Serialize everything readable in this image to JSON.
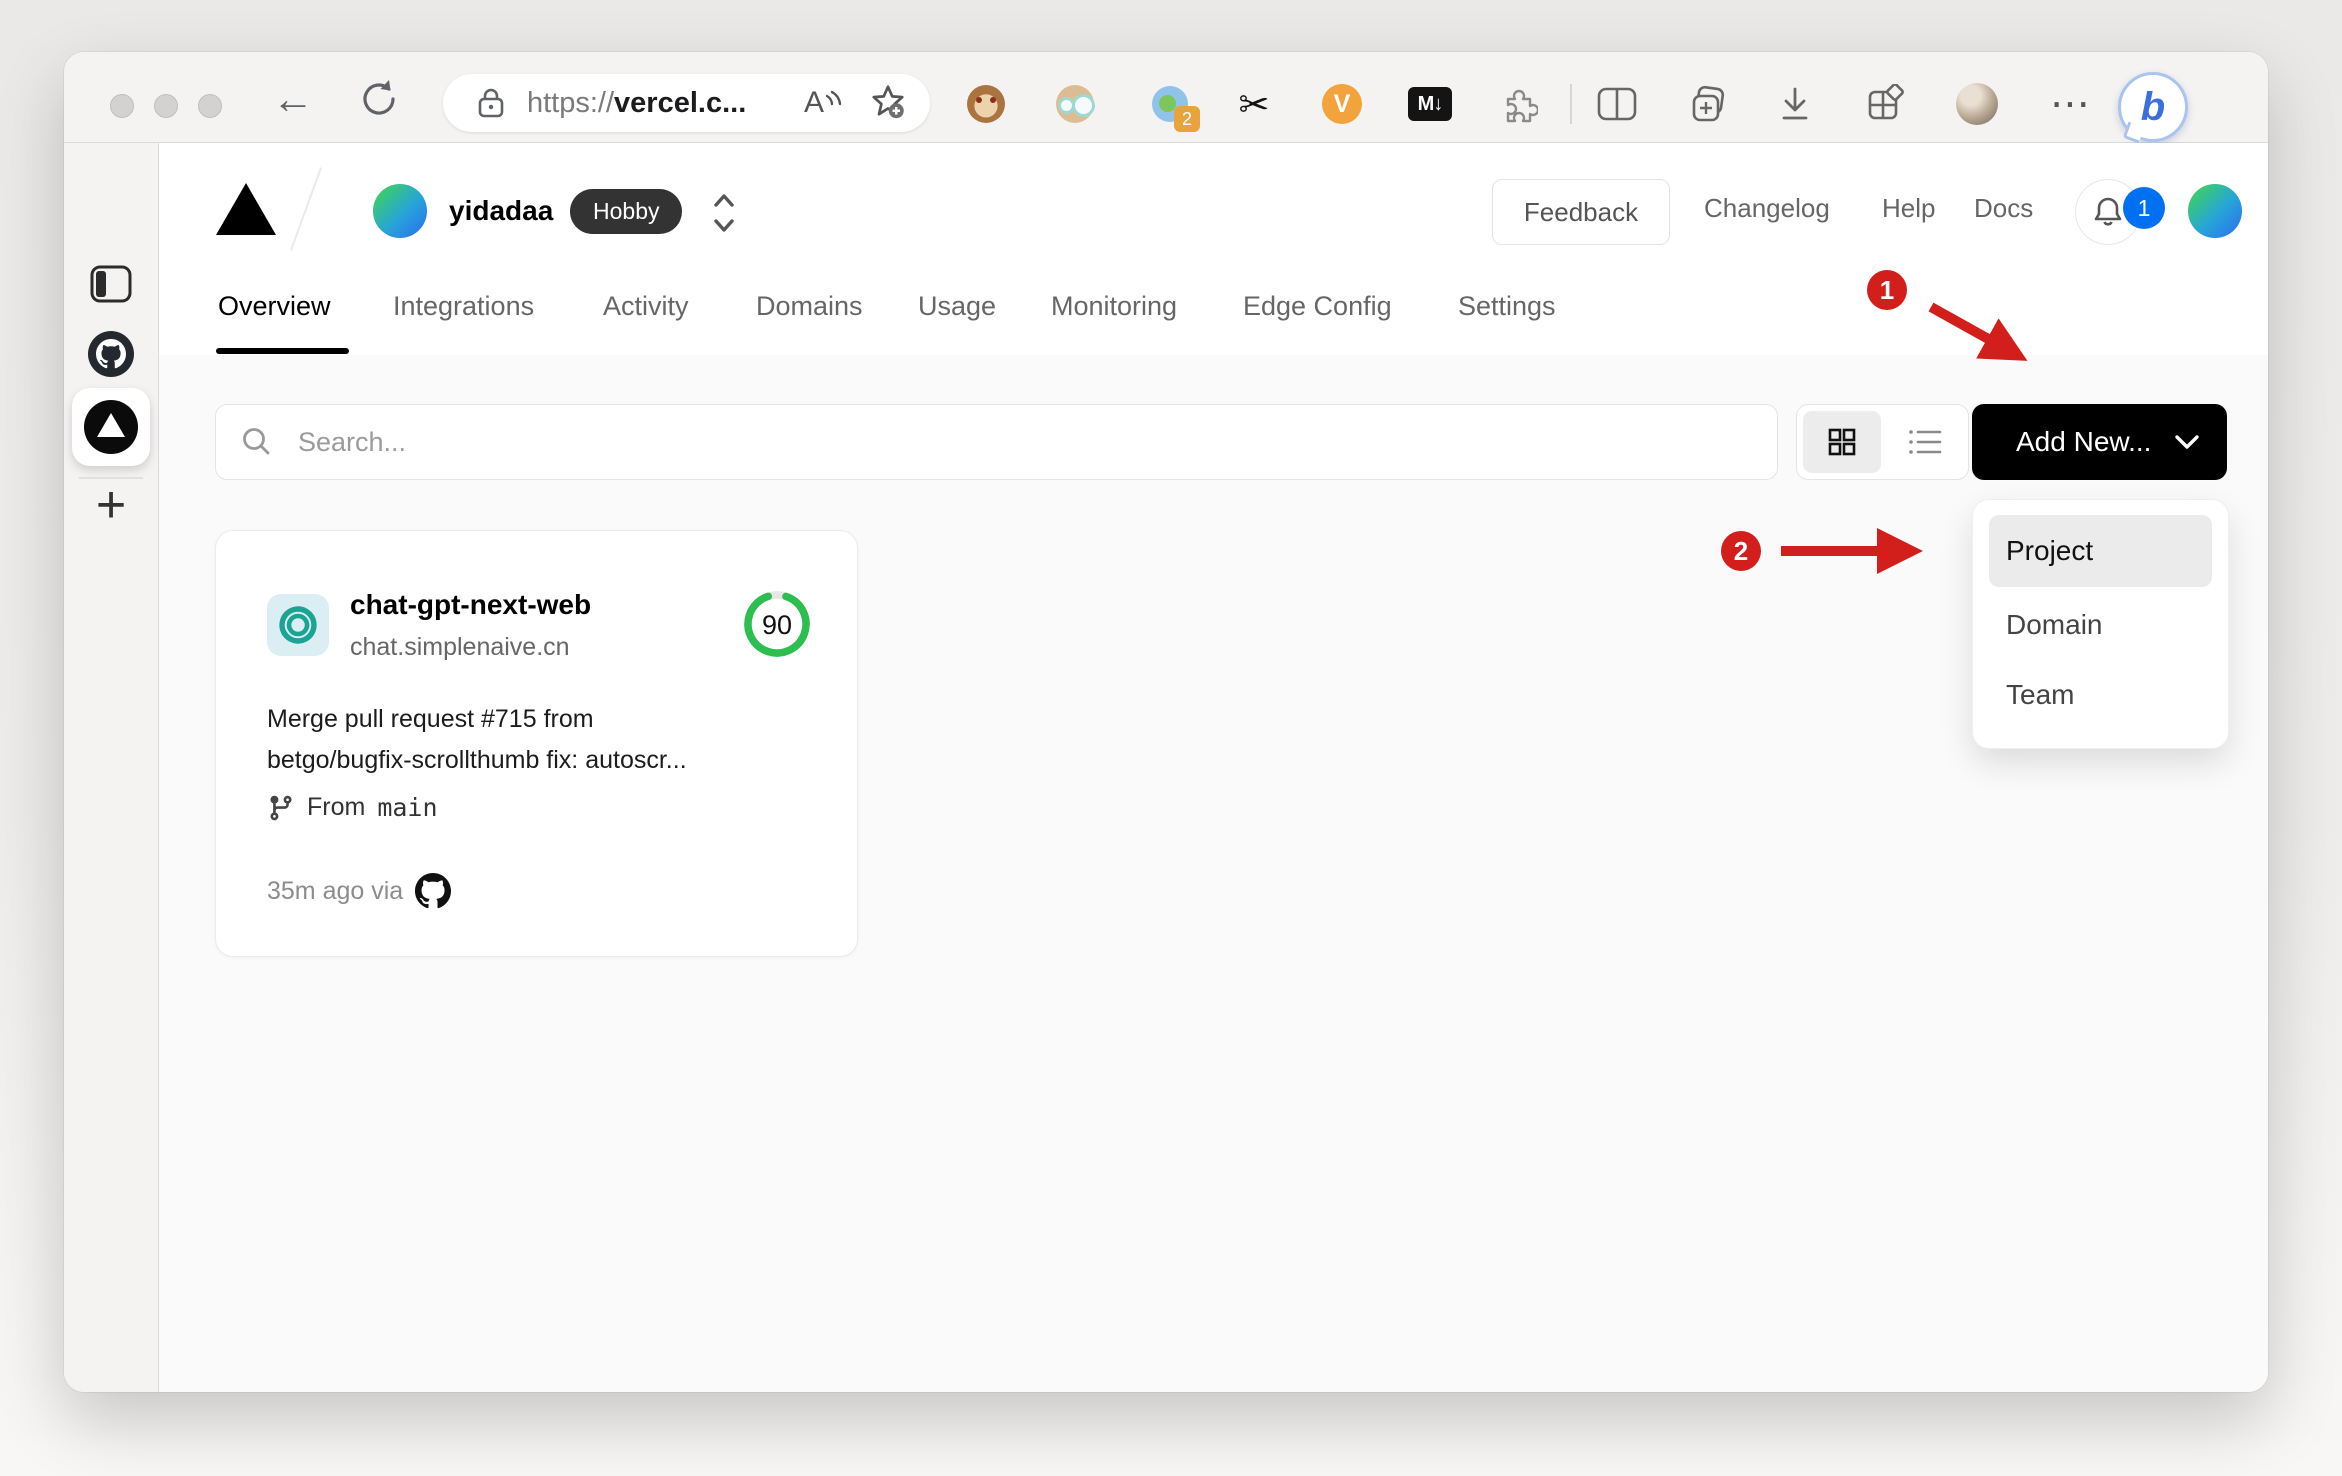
{
  "browser": {
    "back_char": "←",
    "url_bar": {
      "scheme": "https://",
      "host": "vercel.c...",
      "read_aloud_char": "A"
    },
    "extensions": {
      "translate_badge": "2",
      "scissors_char": "✂",
      "video_label": "V",
      "markdown_label": "M↓"
    },
    "more_char": "⋯",
    "copilot_label": "b",
    "strip": {
      "new_tab_char": "+"
    },
    "icon_names": [
      "sidebar-panel",
      "github-tab",
      "vercel-tab-active",
      "new-tab",
      "lock",
      "read-aloud",
      "favorite-star",
      "tampermonkey-monkey",
      "elder-face",
      "translate-circle",
      "scissors",
      "video-downloader",
      "markdown-download",
      "puzzle-extensions",
      "split-screen",
      "collections",
      "download",
      "apps-grid",
      "profile-avatar",
      "more-menu",
      "bing-copilot"
    ]
  },
  "vercel": {
    "team": {
      "name": "yidadaa",
      "plan": "Hobby"
    },
    "header_links": [
      {
        "label": "Feedback"
      },
      {
        "label": "Changelog"
      },
      {
        "label": "Help"
      },
      {
        "label": "Docs"
      }
    ],
    "notifications": {
      "count": "1"
    },
    "tabs": [
      {
        "label": "Overview",
        "active": true
      },
      {
        "label": "Integrations"
      },
      {
        "label": "Activity"
      },
      {
        "label": "Domains"
      },
      {
        "label": "Usage"
      },
      {
        "label": "Monitoring"
      },
      {
        "label": "Edge Config"
      },
      {
        "label": "Settings"
      }
    ],
    "toolbar": {
      "search_placeholder": "Search...",
      "add_new_label": "Add New..."
    },
    "dropdown": {
      "items": [
        {
          "label": "Project",
          "highlighted": true
        },
        {
          "label": "Domain"
        },
        {
          "label": "Team"
        }
      ]
    },
    "project_card": {
      "name": "chat-gpt-next-web",
      "domain": "chat.simplenaive.cn",
      "score": "90",
      "commit_line1": "Merge pull request #715 from",
      "commit_line2": "betgo/bugfix-scrollthumb fix: autoscr...",
      "branch_prefix": "From",
      "branch_name": "main",
      "deploy_meta": "35m ago via"
    },
    "annotations": {
      "step1": "1",
      "step2": "2"
    },
    "colors": {
      "accent_blue": "#0070f3",
      "score_green": "#2cbe4e",
      "annotation_red": "#d21f1b",
      "plan_badge_bg": "#333333"
    }
  }
}
